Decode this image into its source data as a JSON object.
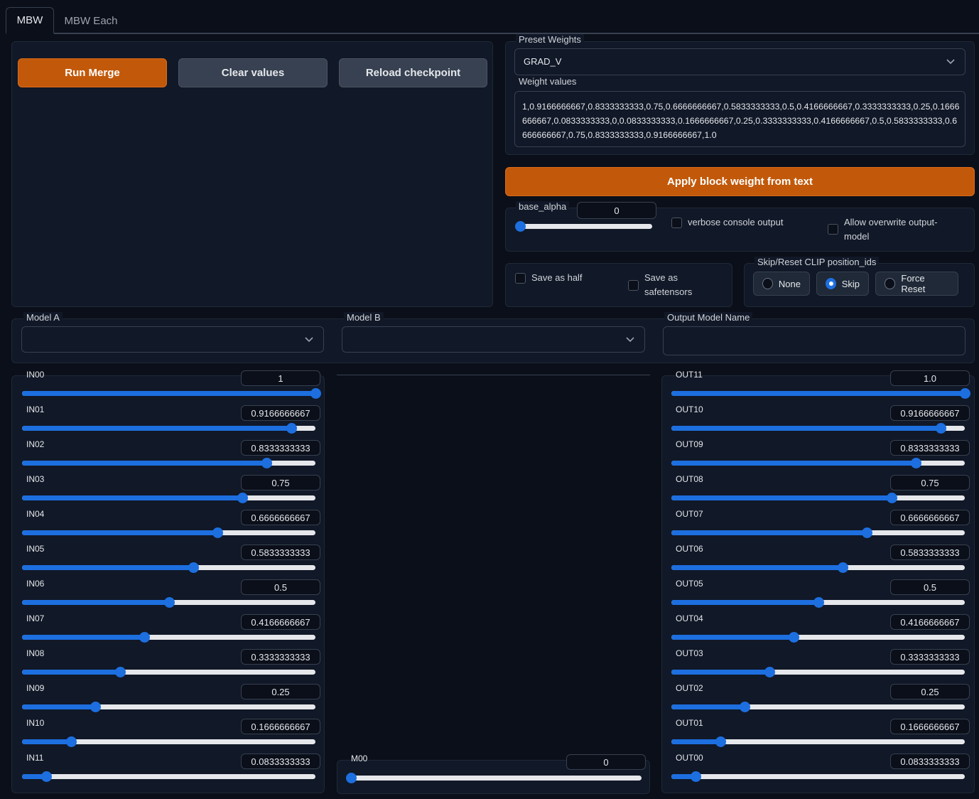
{
  "tabs": [
    {
      "label": "MBW"
    },
    {
      "label": "MBW Each"
    }
  ],
  "actions": {
    "run_merge": "Run Merge",
    "clear_values": "Clear values",
    "reload_checkpoint": "Reload checkpoint",
    "apply_block_weight": "Apply block weight from text"
  },
  "preset": {
    "label": "Preset Weights",
    "selected": "GRAD_V"
  },
  "weight_values": {
    "label": "Weight values",
    "value": "1,0.9166666667,0.8333333333,0.75,0.6666666667,0.5833333333,0.5,0.4166666667,0.3333333333,0.25,0.1666666667,0.0833333333,0,0.0833333333,0.1666666667,0.25,0.3333333333,0.4166666667,0.5,0.5833333333,0.6666666667,0.75,0.8333333333,0.9166666667,1.0"
  },
  "base_alpha": {
    "label": "base_alpha",
    "value": "0",
    "fraction": 0
  },
  "options": {
    "verbose": "verbose console output",
    "allow_overwrite": "Allow overwrite output-model",
    "save_half": "Save as half",
    "save_safetensors": "Save as safetensors"
  },
  "clip": {
    "label": "Skip/Reset CLIP position_ids",
    "options": [
      "None",
      "Skip",
      "Force Reset"
    ],
    "selected": "Skip"
  },
  "models": {
    "model_a_label": "Model A",
    "model_a_value": "",
    "model_b_label": "Model B",
    "model_b_value": "",
    "output_label": "Output Model Name",
    "output_value": ""
  },
  "in_sliders": [
    {
      "label": "IN00",
      "display": "1",
      "value": 1
    },
    {
      "label": "IN01",
      "display": "0.9166666667",
      "value": 0.9166666667
    },
    {
      "label": "IN02",
      "display": "0.8333333333",
      "value": 0.8333333333
    },
    {
      "label": "IN03",
      "display": "0.75",
      "value": 0.75
    },
    {
      "label": "IN04",
      "display": "0.6666666667",
      "value": 0.6666666667
    },
    {
      "label": "IN05",
      "display": "0.5833333333",
      "value": 0.5833333333
    },
    {
      "label": "IN06",
      "display": "0.5",
      "value": 0.5
    },
    {
      "label": "IN07",
      "display": "0.4166666667",
      "value": 0.4166666667
    },
    {
      "label": "IN08",
      "display": "0.3333333333",
      "value": 0.3333333333
    },
    {
      "label": "IN09",
      "display": "0.25",
      "value": 0.25
    },
    {
      "label": "IN10",
      "display": "0.1666666667",
      "value": 0.1666666667
    },
    {
      "label": "IN11",
      "display": "0.0833333333",
      "value": 0.0833333333
    }
  ],
  "mid_slider": {
    "label": "M00",
    "display": "0",
    "value": 0
  },
  "out_sliders": [
    {
      "label": "OUT11",
      "display": "1.0",
      "value": 1.0
    },
    {
      "label": "OUT10",
      "display": "0.9166666667",
      "value": 0.9166666667
    },
    {
      "label": "OUT09",
      "display": "0.8333333333",
      "value": 0.8333333333
    },
    {
      "label": "OUT08",
      "display": "0.75",
      "value": 0.75
    },
    {
      "label": "OUT07",
      "display": "0.6666666667",
      "value": 0.6666666667
    },
    {
      "label": "OUT06",
      "display": "0.5833333333",
      "value": 0.5833333333
    },
    {
      "label": "OUT05",
      "display": "0.5",
      "value": 0.5
    },
    {
      "label": "OUT04",
      "display": "0.4166666667",
      "value": 0.4166666667
    },
    {
      "label": "OUT03",
      "display": "0.3333333333",
      "value": 0.3333333333
    },
    {
      "label": "OUT02",
      "display": "0.25",
      "value": 0.25
    },
    {
      "label": "OUT01",
      "display": "0.1666666667",
      "value": 0.1666666667
    },
    {
      "label": "OUT00",
      "display": "0.0833333333",
      "value": 0.0833333333
    }
  ],
  "colors": {
    "accent_orange": "#c2590a",
    "slider_blue": "#1d6fe0",
    "background": "#0b0f19",
    "panel": "#111827"
  }
}
